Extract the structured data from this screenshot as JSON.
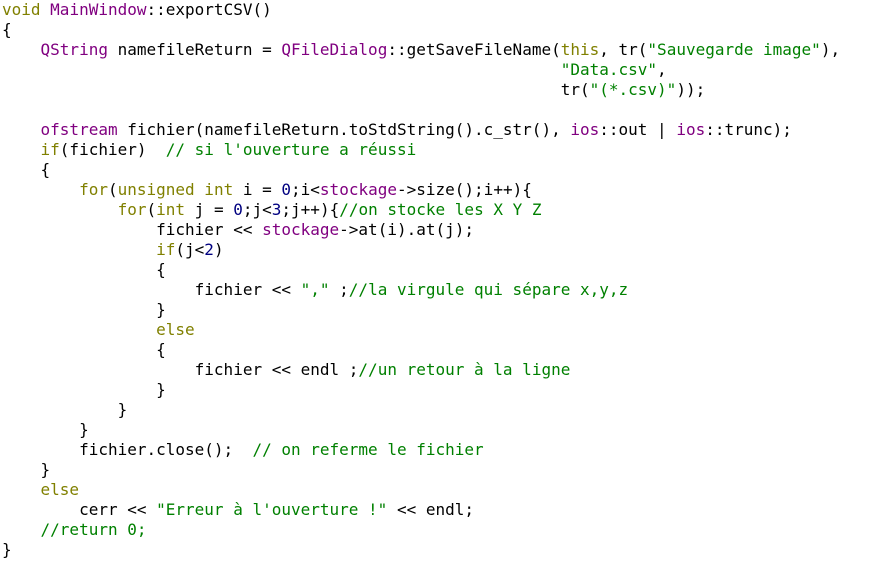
{
  "colors": {
    "background": "#ffffff",
    "keyword": "#808000",
    "type": "#800080",
    "comment": "#008000",
    "string": "#008000",
    "number": "#000080",
    "plain": "#000000"
  },
  "lines": [
    [
      {
        "c": "kw",
        "t": "void"
      },
      {
        "c": "pl",
        "t": " "
      },
      {
        "c": "ty",
        "t": "MainWindow"
      },
      {
        "c": "pl",
        "t": "::exportCSV()"
      }
    ],
    [
      {
        "c": "pl",
        "t": "{"
      }
    ],
    [
      {
        "c": "pl",
        "t": "    "
      },
      {
        "c": "ty",
        "t": "QString"
      },
      {
        "c": "pl",
        "t": " namefileReturn = "
      },
      {
        "c": "ty",
        "t": "QFileDialog"
      },
      {
        "c": "pl",
        "t": "::getSaveFileName("
      },
      {
        "c": "kw",
        "t": "this"
      },
      {
        "c": "pl",
        "t": ", tr("
      },
      {
        "c": "st",
        "t": "\"Sauvegarde image\""
      },
      {
        "c": "pl",
        "t": "),"
      }
    ],
    [
      {
        "c": "pl",
        "t": "                                                          "
      },
      {
        "c": "st",
        "t": "\"Data.csv\""
      },
      {
        "c": "pl",
        "t": ","
      }
    ],
    [
      {
        "c": "pl",
        "t": "                                                          tr("
      },
      {
        "c": "st",
        "t": "\"(*.csv)\""
      },
      {
        "c": "pl",
        "t": "));"
      }
    ],
    [
      {
        "c": "pl",
        "t": ""
      }
    ],
    [
      {
        "c": "pl",
        "t": "    "
      },
      {
        "c": "ty",
        "t": "ofstream"
      },
      {
        "c": "pl",
        "t": " fichier(namefileReturn.toStdString().c_str(), "
      },
      {
        "c": "ty",
        "t": "ios"
      },
      {
        "c": "pl",
        "t": "::out | "
      },
      {
        "c": "ty",
        "t": "ios"
      },
      {
        "c": "pl",
        "t": "::trunc);"
      }
    ],
    [
      {
        "c": "pl",
        "t": "    "
      },
      {
        "c": "kw",
        "t": "if"
      },
      {
        "c": "pl",
        "t": "(fichier)  "
      },
      {
        "c": "cm",
        "t": "// si l'ouverture a réussi"
      }
    ],
    [
      {
        "c": "pl",
        "t": "    {"
      }
    ],
    [
      {
        "c": "pl",
        "t": "        "
      },
      {
        "c": "kw",
        "t": "for"
      },
      {
        "c": "pl",
        "t": "("
      },
      {
        "c": "kw",
        "t": "unsigned int"
      },
      {
        "c": "pl",
        "t": " i = "
      },
      {
        "c": "nm",
        "t": "0"
      },
      {
        "c": "pl",
        "t": ";i<"
      },
      {
        "c": "ty",
        "t": "stockage"
      },
      {
        "c": "pl",
        "t": "->size();i++){"
      }
    ],
    [
      {
        "c": "pl",
        "t": "            "
      },
      {
        "c": "kw",
        "t": "for"
      },
      {
        "c": "pl",
        "t": "("
      },
      {
        "c": "kw",
        "t": "int"
      },
      {
        "c": "pl",
        "t": " j = "
      },
      {
        "c": "nm",
        "t": "0"
      },
      {
        "c": "pl",
        "t": ";j<"
      },
      {
        "c": "nm",
        "t": "3"
      },
      {
        "c": "pl",
        "t": ";j++){"
      },
      {
        "c": "cm",
        "t": "//on stocke les X Y Z"
      }
    ],
    [
      {
        "c": "pl",
        "t": "                fichier << "
      },
      {
        "c": "ty",
        "t": "stockage"
      },
      {
        "c": "pl",
        "t": "->at(i).at(j);"
      }
    ],
    [
      {
        "c": "pl",
        "t": "                "
      },
      {
        "c": "kw",
        "t": "if"
      },
      {
        "c": "pl",
        "t": "(j<"
      },
      {
        "c": "nm",
        "t": "2"
      },
      {
        "c": "pl",
        "t": ")"
      }
    ],
    [
      {
        "c": "pl",
        "t": "                {"
      }
    ],
    [
      {
        "c": "pl",
        "t": "                    fichier << "
      },
      {
        "c": "st",
        "t": "\",\""
      },
      {
        "c": "pl",
        "t": " ;"
      },
      {
        "c": "cm",
        "t": "//la virgule qui sépare x,y,z"
      }
    ],
    [
      {
        "c": "pl",
        "t": "                }"
      }
    ],
    [
      {
        "c": "pl",
        "t": "                "
      },
      {
        "c": "kw",
        "t": "else"
      }
    ],
    [
      {
        "c": "pl",
        "t": "                {"
      }
    ],
    [
      {
        "c": "pl",
        "t": "                    fichier << endl ;"
      },
      {
        "c": "cm",
        "t": "//un retour à la ligne"
      }
    ],
    [
      {
        "c": "pl",
        "t": "                }"
      }
    ],
    [
      {
        "c": "pl",
        "t": "            }"
      }
    ],
    [
      {
        "c": "pl",
        "t": "        }"
      }
    ],
    [
      {
        "c": "pl",
        "t": "        fichier.close();  "
      },
      {
        "c": "cm",
        "t": "// on referme le fichier"
      }
    ],
    [
      {
        "c": "pl",
        "t": "    }"
      }
    ],
    [
      {
        "c": "pl",
        "t": "    "
      },
      {
        "c": "kw",
        "t": "else"
      }
    ],
    [
      {
        "c": "pl",
        "t": "        cerr << "
      },
      {
        "c": "st",
        "t": "\"Erreur à l'ouverture !\""
      },
      {
        "c": "pl",
        "t": " << endl;"
      }
    ],
    [
      {
        "c": "pl",
        "t": "    "
      },
      {
        "c": "cm",
        "t": "//return 0;"
      }
    ],
    [
      {
        "c": "pl",
        "t": "}"
      }
    ]
  ]
}
